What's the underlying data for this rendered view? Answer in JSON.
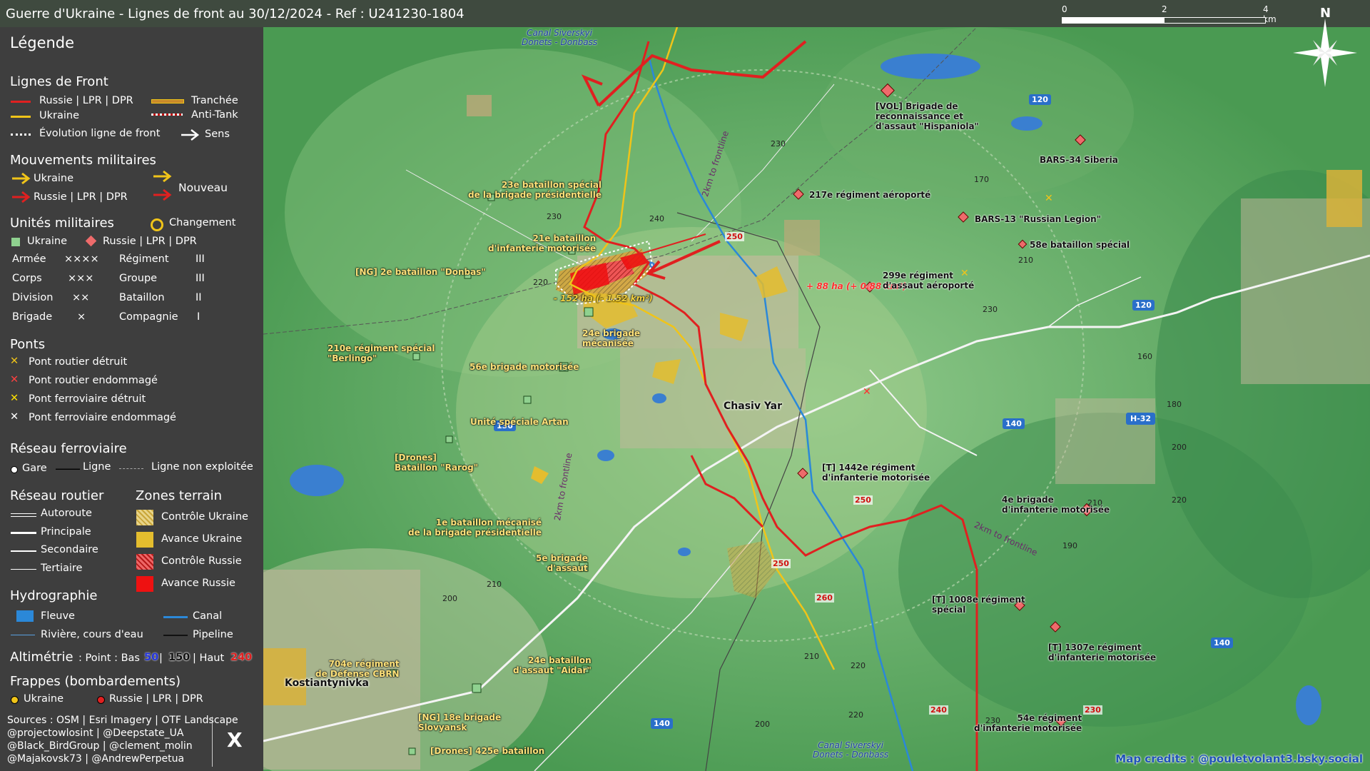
{
  "title": "Guerre d'Ukraine - Lignes de front au 30/12/2024 - Ref : U241230-1804",
  "scale": {
    "labels": [
      "0",
      "2",
      "4 km"
    ]
  },
  "north": "N",
  "legend": {
    "title": "Légende",
    "front": {
      "heading": "Lignes de Front",
      "russia": "Russie | LPR | DPR",
      "ukraine": "Ukraine",
      "evolution": "Évolution ligne de front",
      "trench": "Tranchée",
      "antitank": "Anti-Tank",
      "direction": "Sens"
    },
    "movements": {
      "heading": "Mouvements militaires",
      "ukraine": "Ukraine",
      "russia": "Russie | LPR | DPR",
      "new": "Nouveau"
    },
    "units": {
      "heading": "Unités militaires",
      "change": "Changement",
      "ukraine": "Ukraine",
      "russia": "Russie | LPR | DPR",
      "sizes": [
        {
          "name": "Armée",
          "sym": "××××"
        },
        {
          "name": "Corps",
          "sym": "×××"
        },
        {
          "name": "Division",
          "sym": "××"
        },
        {
          "name": "Brigade",
          "sym": "×"
        },
        {
          "name": "Régiment",
          "sym": "III"
        },
        {
          "name": "Groupe",
          "sym": "III"
        },
        {
          "name": "Bataillon",
          "sym": "II"
        },
        {
          "name": "Compagnie",
          "sym": "I"
        }
      ]
    },
    "bridges": {
      "heading": "Ponts",
      "items": [
        "Pont routier détruit",
        "Pont routier endommagé",
        "Pont ferroviaire détruit",
        "Pont ferroviaire endommagé"
      ]
    },
    "rail": {
      "heading": "Réseau ferroviaire",
      "station": "Gare",
      "line": "Ligne",
      "unused": "Ligne non exploitée"
    },
    "roads": {
      "heading": "Réseau routier",
      "items": [
        "Autoroute",
        "Principale",
        "Secondaire",
        "Tertiaire"
      ]
    },
    "zones": {
      "heading": "Zones terrain",
      "items": [
        "Contrôle Ukraine",
        "Avance Ukraine",
        "Contrôle Russie",
        "Avance Russie"
      ]
    },
    "hydro": {
      "heading": "Hydrographie",
      "river": "Fleuve",
      "canal": "Canal",
      "stream": "Rivière, cours d'eau",
      "pipeline": "Pipeline"
    },
    "altimetry": {
      "label": "Altimétrie",
      "rest": ": Point : Bas",
      "low": "50",
      "mid": "150",
      "high_label": "| Haut",
      "high": "240"
    },
    "strikes": {
      "heading": "Frappes (bombardements)",
      "ukraine": "Ukraine",
      "russia": "Russie | LPR | DPR"
    },
    "sources": [
      "Sources : OSM | Esri Imagery | OTF Landscape",
      "@projectowlosint | @Deepstate_UA",
      "@Black_BirdGroup | @clement_molin",
      "@Majakovsk73 | @AndrewPerpetua"
    ],
    "x_logo": "X"
  },
  "map": {
    "towns": [
      "Chasiv Yar",
      "Kostiantynivka"
    ],
    "canal_labels": [
      "Canal Siverskyi\nDonets - Donbass",
      "Canal Siverskyi\nDonets - Donbass"
    ],
    "distance_labels": [
      "2km to frontline",
      "2km to frontline",
      "2km to frontline"
    ],
    "delta_ua": "- 152 ha (- 1.52 km²)",
    "delta_ru": "+ 88 ha (+ 0.88 km²)",
    "road_numbers": [
      "120",
      "120",
      "130",
      "140",
      "140",
      "140",
      "H-32"
    ],
    "alt_points": [
      "250",
      "250",
      "250",
      "260",
      "240",
      "230"
    ],
    "elevations": [
      "230",
      "240",
      "230",
      "220",
      "170",
      "210",
      "230",
      "160",
      "180",
      "200",
      "210",
      "220",
      "210",
      "200",
      "220",
      "210",
      "220",
      "230",
      "200",
      "190"
    ],
    "units_ua": [
      "23e bataillon spécial\nde la brigade présidentielle",
      "21e bataillon\nd'infanterie motorisée",
      "[NG] 2e bataillon \"Donbas\"",
      "24e brigade\nmécanisée",
      "210e régiment spécial\n\"Berlingo\"",
      "56e brigade motorisée",
      "Unité spéciale Artan",
      "[Drones]\nBataillon \"Rarog\"",
      "1e bataillon mécanisé\nde la brigade présidentielle",
      "5e brigade\nd'assaut",
      "704e régiment\nde Défense CBRN",
      "24e bataillon\nd'assaut \"Aidar\"",
      "[NG] 18e brigade\nSlovyansk",
      "[Drones] 425e bataillon"
    ],
    "units_ru": [
      "[VOL] Brigade de\nreconnaissance et\nd'assaut \"Hispaniola\"",
      "BARS-34 Siberia",
      "217e régiment aéroporté",
      "BARS-13 \"Russian Legion\"",
      "58e bataillon spécial",
      "299e régiment\nd'assaut aéroporté",
      "[T] 1442e régiment\nd'infanterie motorisée",
      "4e brigade\nd'infanterie motorisée",
      "[T] 1008e régiment\nspécial",
      "[T] 1307e régiment\nd'infanterie motorisée",
      "54e régiment\nd'infanterie motorisée"
    ],
    "credit": "Map credits : @pouletvolant3.bsky.social"
  },
  "colors": {
    "russia": "#e02020",
    "ukraine": "#f0c419",
    "legend_bg": "#3e3e3e",
    "title_bg": "#3f4a3f",
    "ua_unit": "#8fd18f",
    "ru_unit": "#ee6b6b",
    "water": "#3a7fd0"
  }
}
